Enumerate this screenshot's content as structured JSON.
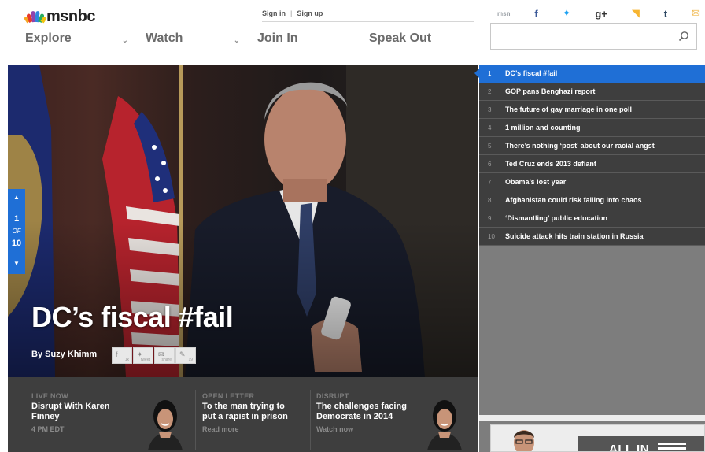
{
  "brand": {
    "name": "msnbc",
    "peacock_colors": [
      "#f5a623",
      "#e8392b",
      "#8e44ad",
      "#2e86de",
      "#27ae60",
      "#f1c40f"
    ]
  },
  "header": {
    "nav": [
      {
        "label": "Explore",
        "has_dropdown": true
      },
      {
        "label": "Watch",
        "has_dropdown": true
      },
      {
        "label": "Join In",
        "has_dropdown": false
      },
      {
        "label": "Speak Out",
        "has_dropdown": false
      }
    ],
    "auth": {
      "sign_in": "Sign in",
      "separator": "|",
      "sign_up": "Sign up"
    },
    "socials": [
      {
        "name": "msnbc-icon",
        "glyph": "msn",
        "color": "#9aa0a6"
      },
      {
        "name": "facebook-icon",
        "glyph": "f",
        "color": "#3b5998"
      },
      {
        "name": "twitter-icon",
        "glyph": "✦",
        "color": "#1da1f2"
      },
      {
        "name": "google-plus-icon",
        "glyph": "g+",
        "color": "#333333"
      },
      {
        "name": "rss-icon",
        "glyph": "◥",
        "color": "#f7b531"
      },
      {
        "name": "tumblr-icon",
        "glyph": "t",
        "color": "#2c4762"
      },
      {
        "name": "email-icon",
        "glyph": "✉",
        "color": "#f0b74a"
      }
    ],
    "search": {
      "value": "",
      "placeholder": ""
    }
  },
  "hero": {
    "title": "DC’s fiscal #fail",
    "byline": "By Suzy Khimm",
    "pager": {
      "current": "1",
      "of": "OF",
      "total": "10"
    },
    "share_buttons": [
      {
        "name": "facebook-share",
        "glyph": "f",
        "count": "1k"
      },
      {
        "name": "tweet-share",
        "glyph": "✦",
        "count": "tweet"
      },
      {
        "name": "email-share",
        "glyph": "✉",
        "count": "share"
      },
      {
        "name": "comment-share",
        "glyph": "✎",
        "count": "19"
      }
    ]
  },
  "promos": [
    {
      "kicker": "LIVE NOW",
      "headline": [
        "Disrupt With Karen",
        "Finney"
      ],
      "meta": "4 PM EDT"
    },
    {
      "kicker": "OPEN LETTER",
      "headline": [
        "To the man trying to",
        "put a rapist in prison"
      ],
      "meta": "Read more"
    },
    {
      "kicker": "DISRUPT",
      "headline": [
        "The challenges facing",
        "Democrats in 2014"
      ],
      "meta": "Watch now"
    }
  ],
  "toplist": {
    "items": [
      {
        "rank": "1",
        "title": "DC’s fiscal #fail",
        "active": true
      },
      {
        "rank": "2",
        "title": "GOP pans Benghazi report",
        "active": false
      },
      {
        "rank": "3",
        "title": "The future of gay marriage in one poll",
        "active": false
      },
      {
        "rank": "4",
        "title": "1 million and counting",
        "active": false
      },
      {
        "rank": "5",
        "title": "There’s nothing ‘post’ about our racial angst",
        "active": false
      },
      {
        "rank": "6",
        "title": "Ted Cruz ends 2013 defiant",
        "active": false
      },
      {
        "rank": "7",
        "title": "Obama’s lost year",
        "active": false
      },
      {
        "rank": "8",
        "title": "Afghanistan could risk falling into chaos",
        "active": false
      },
      {
        "rank": "9",
        "title": "‘Dismantling’ public education",
        "active": false
      },
      {
        "rank": "10",
        "title": "Suicide attack hits train station in Russia",
        "active": false
      }
    ]
  },
  "rail_promo": {
    "label": "ALL IN"
  },
  "colors": {
    "accent": "#1f6fd6",
    "dark_panel": "#3e3e3e",
    "rail_gray": "#7d7d7d"
  }
}
